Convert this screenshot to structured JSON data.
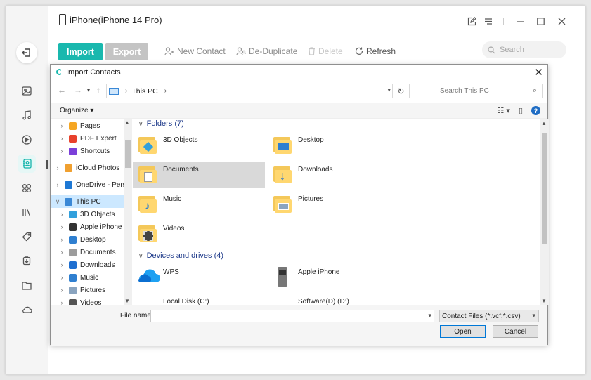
{
  "app": {
    "device_title": "iPhone(iPhone 14 Pro)",
    "accent_color": "#19b8ae"
  },
  "window_controls": [
    "feedback-icon",
    "menu-icon",
    "minimize-icon",
    "maximize-icon",
    "close-icon"
  ],
  "rail": {
    "icons": [
      "photos-icon",
      "music-icon",
      "videos-icon",
      "contacts-icon",
      "apps-icon",
      "books-icon",
      "tags-icon",
      "backup-icon",
      "files-icon",
      "cloud-icon"
    ],
    "active": "contacts-icon"
  },
  "toolbar": {
    "import_label": "Import",
    "export_label": "Export",
    "new_contact_label": "New Contact",
    "deduplicate_label": "De-Duplicate",
    "delete_label": "Delete",
    "refresh_label": "Refresh",
    "search_placeholder": "Search"
  },
  "dialog": {
    "title": "Import Contacts",
    "address": "This PC",
    "search_placeholder": "Search This PC",
    "organize_label": "Organize ▾",
    "nav_items": [
      {
        "label": "Pages",
        "icon_color": "#f5a623",
        "indent": 1
      },
      {
        "label": "PDF Expert",
        "icon_color": "#e8412c",
        "indent": 1
      },
      {
        "label": "Shortcuts",
        "icon_color": "#7b3fd9",
        "indent": 1
      },
      {
        "label": "iCloud Photos",
        "icon_color": "#f0a030",
        "indent": 0
      },
      {
        "label": "OneDrive - Person",
        "icon_color": "#1e78d4",
        "indent": 0
      },
      {
        "label": "This PC",
        "icon_color": "#3a88d6",
        "indent": 0
      },
      {
        "label": "3D Objects",
        "icon_color": "#32a0dc",
        "indent": 1
      },
      {
        "label": "Apple iPhone",
        "icon_color": "#333333",
        "indent": 1
      },
      {
        "label": "Desktop",
        "icon_color": "#2f7fd0",
        "indent": 1
      },
      {
        "label": "Documents",
        "icon_color": "#9c9c9c",
        "indent": 1
      },
      {
        "label": "Downloads",
        "icon_color": "#1e6fd0",
        "indent": 1
      },
      {
        "label": "Music",
        "icon_color": "#2f7fd0",
        "indent": 1
      },
      {
        "label": "Pictures",
        "icon_color": "#8aa4bf",
        "indent": 1
      },
      {
        "label": "Videos",
        "icon_color": "#555555",
        "indent": 1
      }
    ],
    "folders_header": "Folders (7)",
    "folders": [
      "3D Objects",
      "Desktop",
      "Documents",
      "Downloads",
      "Music",
      "Pictures",
      "Videos"
    ],
    "selected_folder": "Documents",
    "devices_header": "Devices and drives (4)",
    "devices": [
      "WPS",
      "Apple iPhone",
      "Local Disk (C:)",
      "Software(D) (D:)"
    ],
    "file_name_label": "File name:",
    "file_name_value": "",
    "file_type": "Contact Files (*.vcf;*.csv)",
    "open_label": "Open",
    "cancel_label": "Cancel"
  }
}
